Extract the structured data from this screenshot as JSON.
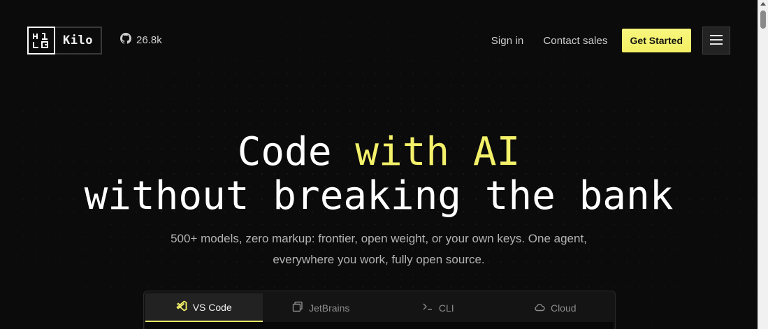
{
  "header": {
    "logo_text": "Kilo",
    "github_stars": "26.8k",
    "sign_in": "Sign in",
    "contact_sales": "Contact sales",
    "get_started": "Get Started"
  },
  "hero": {
    "title_line1_plain": "Code ",
    "title_line1_accent": "with AI",
    "title_line2": "without breaking the bank",
    "subtitle_line1": "500+ models, zero markup: frontier, open weight, or your own keys. One agent,",
    "subtitle_line2": "everywhere you work, fully open source."
  },
  "tabs": [
    {
      "label": "VS Code",
      "icon": "vscode-icon",
      "active": true
    },
    {
      "label": "JetBrains",
      "icon": "jetbrains-icon",
      "active": false
    },
    {
      "label": "CLI",
      "icon": "terminal-icon",
      "active": false
    },
    {
      "label": "Cloud",
      "icon": "cloud-icon",
      "active": false
    }
  ],
  "colors": {
    "accent": "#f3f06a",
    "background": "#0b0b0b",
    "muted_text": "#b3b3b3"
  }
}
